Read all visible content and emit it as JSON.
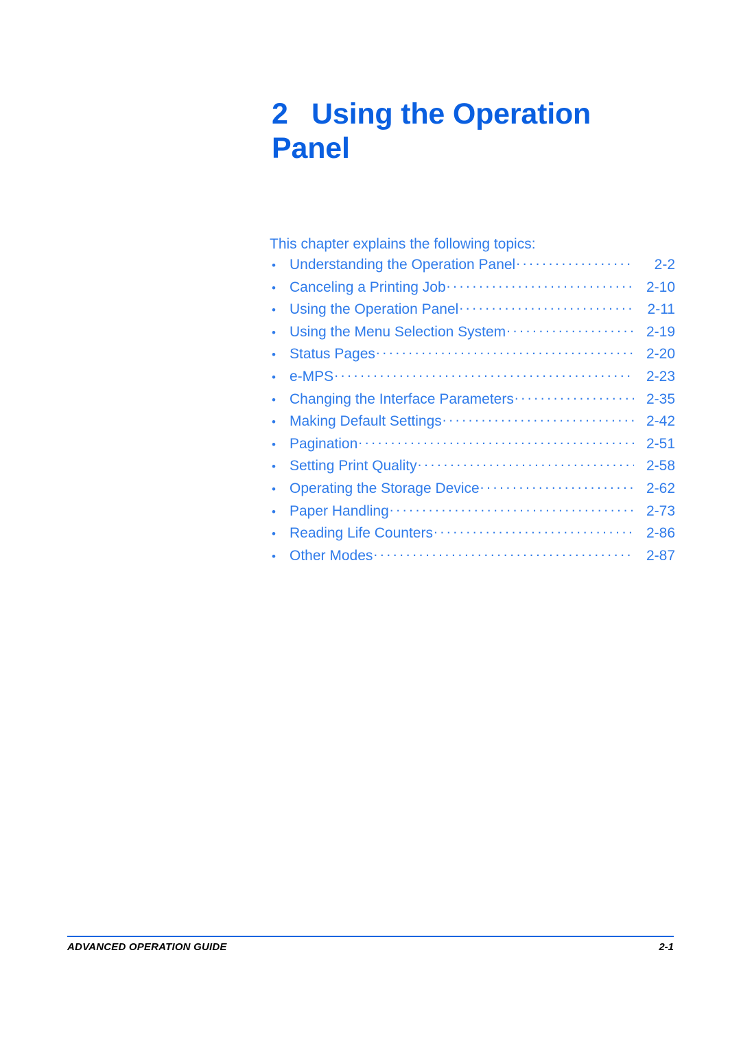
{
  "document": {
    "chapter_number": "2",
    "chapter_title": "Using the Operation Panel",
    "intro": "This chapter explains the following topics:",
    "accent_color": "#0a5fe0",
    "toc_color": "#2f7bea",
    "rule_color": "#1565e0"
  },
  "toc": {
    "bullet_glyph": "•",
    "entries": [
      {
        "label": "Understanding the Operation Panel",
        "page": "2-2"
      },
      {
        "label": "Canceling a Printing Job",
        "page": "2-10"
      },
      {
        "label": "Using the Operation Panel",
        "page": "2-11"
      },
      {
        "label": "Using the Menu Selection System",
        "page": "2-19"
      },
      {
        "label": "Status Pages",
        "page": "2-20"
      },
      {
        "label": "e-MPS",
        "page": "2-23"
      },
      {
        "label": "Changing the Interface Parameters",
        "page": "2-35"
      },
      {
        "label": "Making Default Settings",
        "page": "2-42"
      },
      {
        "label": "Pagination",
        "page": "2-51"
      },
      {
        "label": "Setting Print Quality",
        "page": "2-58"
      },
      {
        "label": "Operating the Storage Device",
        "page": "2-62"
      },
      {
        "label": "Paper Handling",
        "page": "2-73"
      },
      {
        "label": "Reading Life Counters",
        "page": "2-86"
      },
      {
        "label": "Other Modes",
        "page": "2-87"
      }
    ]
  },
  "footer": {
    "guide_name": "ADVANCED OPERATION GUIDE",
    "page_number": "2-1"
  }
}
